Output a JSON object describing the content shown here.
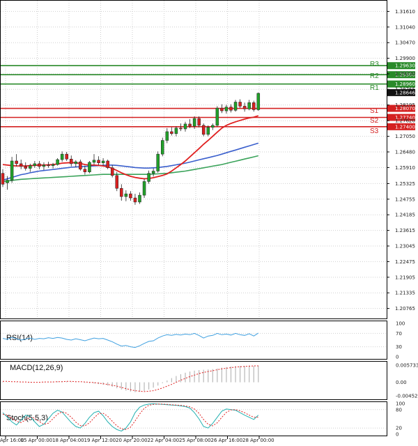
{
  "colors": {
    "bull": "#22a02a",
    "bear": "#d92020",
    "pivot_resistance": "#2a8a2a",
    "pivot_support": "#d42020",
    "ma_fast": "#e02020",
    "ma_mid": "#3a5fcd",
    "ma_slow": "#3aa35a",
    "rsi": "#3fa0e0",
    "macd_hist": "#b8b8b8",
    "macd_signal": "#e02020",
    "stoch_k": "#20b0b0",
    "stoch_d": "#e02020",
    "grid": "#cfcfcf"
  },
  "chart_data": {
    "type": "candlestick",
    "price_axis": {
      "range": [
        1.2045,
        1.319
      ],
      "ticks": [
        "1.31610",
        "1.31040",
        "1.30470",
        "1.29900",
        "1.29330",
        "1.28765",
        "1.28195",
        "1.27620",
        "1.27050",
        "1.26480",
        "1.25910",
        "1.25325",
        "1.24755",
        "1.24185",
        "1.23615",
        "1.23045",
        "1.22475",
        "1.21905",
        "1.21335",
        "1.20765"
      ],
      "current_price_label": "1.28646",
      "grid": true
    },
    "pivot_levels": [
      {
        "name": "R3",
        "value": 1.2963,
        "label": "1.29630",
        "kind": "resistance"
      },
      {
        "name": "R2",
        "value": 1.293,
        "label": "1.29300",
        "kind": "resistance"
      },
      {
        "name": "R1",
        "value": 1.2896,
        "label": "1.28960",
        "kind": "resistance"
      },
      {
        "name": "",
        "value": 1.2807,
        "label": "1.28070",
        "kind": "support"
      },
      {
        "name": "S1",
        "value": 1.2774,
        "label": "1.27740",
        "kind": "support"
      },
      {
        "name": "S2",
        "value": 1.274,
        "label": "1.27400",
        "kind": "support"
      },
      {
        "name": "S3",
        "value": null,
        "label": "",
        "kind": "support"
      }
    ],
    "x_labels": [
      "Apr 16:00",
      "15 Apr 00:00",
      "18 Apr 04:00",
      "19 Apr 12:00",
      "20 Apr 20:00",
      "22 Apr 04:00",
      "25 Apr 08:00",
      "26 Apr 16:00",
      "28 Apr 00:00"
    ],
    "candles": [
      {
        "o": 1.257,
        "h": 1.2585,
        "l": 1.252,
        "c": 1.253
      },
      {
        "o": 1.2535,
        "h": 1.256,
        "l": 1.251,
        "c": 1.2545
      },
      {
        "o": 1.2545,
        "h": 1.263,
        "l": 1.2535,
        "c": 1.2615
      },
      {
        "o": 1.2615,
        "h": 1.264,
        "l": 1.2595,
        "c": 1.2605
      },
      {
        "o": 1.2605,
        "h": 1.262,
        "l": 1.2585,
        "c": 1.2595
      },
      {
        "o": 1.2595,
        "h": 1.261,
        "l": 1.258,
        "c": 1.2588
      },
      {
        "o": 1.2588,
        "h": 1.2605,
        "l": 1.2575,
        "c": 1.2598
      },
      {
        "o": 1.2598,
        "h": 1.2615,
        "l": 1.259,
        "c": 1.2605
      },
      {
        "o": 1.2605,
        "h": 1.2615,
        "l": 1.2585,
        "c": 1.2595
      },
      {
        "o": 1.2595,
        "h": 1.261,
        "l": 1.2582,
        "c": 1.26
      },
      {
        "o": 1.26,
        "h": 1.2612,
        "l": 1.259,
        "c": 1.2598
      },
      {
        "o": 1.2598,
        "h": 1.2608,
        "l": 1.2588,
        "c": 1.2602
      },
      {
        "o": 1.2602,
        "h": 1.2625,
        "l": 1.2598,
        "c": 1.262
      },
      {
        "o": 1.262,
        "h": 1.265,
        "l": 1.2612,
        "c": 1.264
      },
      {
        "o": 1.264,
        "h": 1.2648,
        "l": 1.2615,
        "c": 1.2622
      },
      {
        "o": 1.2622,
        "h": 1.2635,
        "l": 1.2595,
        "c": 1.2605
      },
      {
        "o": 1.2605,
        "h": 1.2618,
        "l": 1.2592,
        "c": 1.2612
      },
      {
        "o": 1.2612,
        "h": 1.262,
        "l": 1.258,
        "c": 1.2585
      },
      {
        "o": 1.2585,
        "h": 1.2598,
        "l": 1.2565,
        "c": 1.2575
      },
      {
        "o": 1.2575,
        "h": 1.2615,
        "l": 1.257,
        "c": 1.261
      },
      {
        "o": 1.261,
        "h": 1.264,
        "l": 1.2602,
        "c": 1.2618
      },
      {
        "o": 1.2618,
        "h": 1.2632,
        "l": 1.26,
        "c": 1.2608
      },
      {
        "o": 1.2608,
        "h": 1.2625,
        "l": 1.2598,
        "c": 1.2615
      },
      {
        "o": 1.2615,
        "h": 1.262,
        "l": 1.2585,
        "c": 1.259
      },
      {
        "o": 1.259,
        "h": 1.26,
        "l": 1.2555,
        "c": 1.2562
      },
      {
        "o": 1.2562,
        "h": 1.2575,
        "l": 1.2505,
        "c": 1.2515
      },
      {
        "o": 1.2515,
        "h": 1.253,
        "l": 1.247,
        "c": 1.2485
      },
      {
        "o": 1.2485,
        "h": 1.2508,
        "l": 1.2468,
        "c": 1.2495
      },
      {
        "o": 1.2495,
        "h": 1.2505,
        "l": 1.247,
        "c": 1.248
      },
      {
        "o": 1.248,
        "h": 1.2495,
        "l": 1.2455,
        "c": 1.2465
      },
      {
        "o": 1.2465,
        "h": 1.25,
        "l": 1.2458,
        "c": 1.249
      },
      {
        "o": 1.249,
        "h": 1.255,
        "l": 1.248,
        "c": 1.254
      },
      {
        "o": 1.254,
        "h": 1.258,
        "l": 1.2532,
        "c": 1.257
      },
      {
        "o": 1.257,
        "h": 1.2588,
        "l": 1.2558,
        "c": 1.2578
      },
      {
        "o": 1.2578,
        "h": 1.265,
        "l": 1.2572,
        "c": 1.264
      },
      {
        "o": 1.264,
        "h": 1.27,
        "l": 1.2632,
        "c": 1.269
      },
      {
        "o": 1.269,
        "h": 1.2735,
        "l": 1.268,
        "c": 1.2722
      },
      {
        "o": 1.2722,
        "h": 1.2738,
        "l": 1.2708,
        "c": 1.2715
      },
      {
        "o": 1.2715,
        "h": 1.2742,
        "l": 1.2705,
        "c": 1.2735
      },
      {
        "o": 1.2735,
        "h": 1.2752,
        "l": 1.2724,
        "c": 1.2732
      },
      {
        "o": 1.2732,
        "h": 1.2758,
        "l": 1.2722,
        "c": 1.275
      },
      {
        "o": 1.275,
        "h": 1.2768,
        "l": 1.2735,
        "c": 1.2742
      },
      {
        "o": 1.2742,
        "h": 1.2778,
        "l": 1.2732,
        "c": 1.277
      },
      {
        "o": 1.277,
        "h": 1.2778,
        "l": 1.2738,
        "c": 1.2745
      },
      {
        "o": 1.2745,
        "h": 1.2752,
        "l": 1.2705,
        "c": 1.2712
      },
      {
        "o": 1.2712,
        "h": 1.2745,
        "l": 1.2705,
        "c": 1.2738
      },
      {
        "o": 1.2738,
        "h": 1.2752,
        "l": 1.2728,
        "c": 1.2745
      },
      {
        "o": 1.2745,
        "h": 1.2815,
        "l": 1.274,
        "c": 1.2808
      },
      {
        "o": 1.2808,
        "h": 1.2822,
        "l": 1.279,
        "c": 1.2798
      },
      {
        "o": 1.2798,
        "h": 1.282,
        "l": 1.2788,
        "c": 1.2812
      },
      {
        "o": 1.2812,
        "h": 1.2822,
        "l": 1.2792,
        "c": 1.28
      },
      {
        "o": 1.28,
        "h": 1.2838,
        "l": 1.2795,
        "c": 1.283
      },
      {
        "o": 1.283,
        "h": 1.284,
        "l": 1.2808,
        "c": 1.2815
      },
      {
        "o": 1.2815,
        "h": 1.2828,
        "l": 1.2795,
        "c": 1.2805
      },
      {
        "o": 1.2805,
        "h": 1.2838,
        "l": 1.28,
        "c": 1.2828
      },
      {
        "o": 1.2828,
        "h": 1.2835,
        "l": 1.2795,
        "c": 1.2802
      },
      {
        "o": 1.2802,
        "h": 1.2865,
        "l": 1.2798,
        "c": 1.2862
      }
    ],
    "moving_averages": {
      "fast": [
        1.2602,
        1.26,
        1.2598,
        1.2597,
        1.2597,
        1.2597,
        1.2598,
        1.2599,
        1.26,
        1.26,
        1.2601,
        1.2602,
        1.2604,
        1.2607,
        1.2608,
        1.2609,
        1.2608,
        1.2606,
        1.2602,
        1.26,
        1.26,
        1.2599,
        1.2597,
        1.2594,
        1.2588,
        1.258,
        1.2572,
        1.2565,
        1.2559,
        1.2555,
        1.2552,
        1.255,
        1.2551,
        1.2554,
        1.2558,
        1.2562,
        1.2568,
        1.2578,
        1.259,
        1.2602,
        1.2615,
        1.263,
        1.2645,
        1.266,
        1.2676,
        1.269,
        1.2705,
        1.272,
        1.2735,
        1.2745,
        1.2752,
        1.2758,
        1.2763,
        1.2768,
        1.2772,
        1.2775,
        1.278
      ],
      "mid": [
        1.2545,
        1.255,
        1.2555,
        1.256,
        1.2565,
        1.2568,
        1.2572,
        1.2575,
        1.2578,
        1.258,
        1.2582,
        1.2584,
        1.2586,
        1.2588,
        1.259,
        1.2592,
        1.2593,
        1.2594,
        1.2595,
        1.2596,
        1.2597,
        1.2598,
        1.2599,
        1.26,
        1.26,
        1.2599,
        1.2597,
        1.2595,
        1.2593,
        1.2591,
        1.259,
        1.2589,
        1.2589,
        1.259,
        1.2591,
        1.2593,
        1.2595,
        1.2598,
        1.2601,
        1.2604,
        1.2607,
        1.2611,
        1.2615,
        1.2619,
        1.2623,
        1.2627,
        1.2631,
        1.2635,
        1.264,
        1.2645,
        1.265,
        1.2655,
        1.266,
        1.2665,
        1.267,
        1.2675,
        1.268
      ],
      "slow": [
        1.254,
        1.2542,
        1.2544,
        1.2546,
        1.2548,
        1.2549,
        1.255,
        1.2551,
        1.2552,
        1.2553,
        1.2554,
        1.2555,
        1.2556,
        1.2557,
        1.2558,
        1.2559,
        1.256,
        1.2561,
        1.2562,
        1.2563,
        1.2564,
        1.2565,
        1.2566,
        1.2566,
        1.2566,
        1.2566,
        1.2566,
        1.2566,
        1.2566,
        1.2566,
        1.2566,
        1.2566,
        1.2566,
        1.2567,
        1.2568,
        1.2569,
        1.257,
        1.2572,
        1.2574,
        1.2576,
        1.2578,
        1.2581,
        1.2584,
        1.2587,
        1.259,
        1.2593,
        1.2596,
        1.2599,
        1.2602,
        1.2606,
        1.261,
        1.2614,
        1.2618,
        1.2622,
        1.2626,
        1.263,
        1.2634
      ]
    },
    "rsi": {
      "label": "RSI(14)",
      "range": [
        0,
        100
      ],
      "ticks": [
        "100",
        "70",
        "30",
        "0"
      ],
      "values": [
        55,
        52,
        58,
        54,
        50,
        53,
        56,
        52,
        55,
        54,
        57,
        55,
        58,
        56,
        52,
        50,
        54,
        51,
        48,
        52,
        56,
        54,
        55,
        50,
        45,
        38,
        32,
        34,
        30,
        28,
        33,
        40,
        46,
        48,
        56,
        62,
        66,
        64,
        67,
        65,
        68,
        66,
        70,
        64,
        56,
        62,
        64,
        70,
        66,
        68,
        65,
        70,
        66,
        64,
        69,
        62,
        71
      ]
    },
    "macd": {
      "label": "MACD(12,26,9)",
      "ticks": [
        "0.005733",
        "0.00",
        "-0.004529"
      ],
      "range": [
        -0.005,
        0.0062
      ],
      "histogram": [
        0.0002,
        0.0001,
        0.0,
        0.0001,
        0.0001,
        0.0,
        -0.0001,
        0.0,
        0.0001,
        0.0001,
        0.0002,
        0.0002,
        0.0003,
        0.0004,
        0.0003,
        0.0002,
        0.0001,
        0.0,
        -0.0002,
        -0.0003,
        -0.0004,
        -0.0006,
        -0.0008,
        -0.0011,
        -0.0015,
        -0.002,
        -0.0024,
        -0.0028,
        -0.0031,
        -0.0033,
        -0.0032,
        -0.0029,
        -0.0024,
        -0.0018,
        -0.0011,
        -0.0003,
        0.0006,
        0.0014,
        0.0021,
        0.0027,
        0.0032,
        0.0036,
        0.0039,
        0.0041,
        0.0042,
        0.0043,
        0.0044,
        0.0046,
        0.0049,
        0.0051,
        0.0053,
        0.0054,
        0.0055,
        0.0055,
        0.0056,
        0.0055,
        0.0056
      ],
      "signal": [
        0.0003,
        0.0003,
        0.0002,
        0.0002,
        0.0001,
        0.0001,
        0.0,
        0.0,
        0.0,
        0.0001,
        0.0001,
        0.0001,
        0.0002,
        0.0002,
        0.0003,
        0.0003,
        0.0002,
        0.0002,
        0.0001,
        0.0,
        -0.0001,
        -0.0003,
        -0.0005,
        -0.0007,
        -0.001,
        -0.0013,
        -0.0017,
        -0.0021,
        -0.0025,
        -0.0028,
        -0.003,
        -0.0031,
        -0.003,
        -0.0028,
        -0.0024,
        -0.0019,
        -0.0013,
        -0.0007,
        0.0,
        0.0007,
        0.0013,
        0.0019,
        0.0024,
        0.0029,
        0.0033,
        0.0036,
        0.0039,
        0.0042,
        0.0045,
        0.0047,
        0.0049,
        0.0051,
        0.0052,
        0.0053,
        0.0054,
        0.0055,
        0.0055
      ]
    },
    "stoch": {
      "label": "Stoch(5,5,3)",
      "ticks": [
        "100",
        "80",
        "20",
        "0"
      ],
      "range": [
        0,
        100
      ],
      "k": [
        70,
        55,
        40,
        30,
        45,
        62,
        58,
        40,
        25,
        32,
        50,
        68,
        78,
        72,
        55,
        38,
        25,
        20,
        35,
        55,
        70,
        75,
        60,
        40,
        25,
        15,
        10,
        20,
        40,
        70,
        88,
        95,
        98,
        99,
        98,
        97,
        96,
        95,
        94,
        92,
        90,
        85,
        70,
        50,
        25,
        20,
        35,
        55,
        75,
        82,
        80,
        78,
        70,
        62,
        55,
        48,
        62
      ],
      "d": [
        65,
        62,
        52,
        42,
        38,
        46,
        55,
        52,
        41,
        32,
        36,
        50,
        65,
        73,
        68,
        55,
        39,
        28,
        27,
        37,
        53,
        67,
        68,
        58,
        42,
        27,
        17,
        15,
        23,
        43,
        66,
        84,
        94,
        97,
        98,
        98,
        97,
        96,
        95,
        94,
        92,
        89,
        82,
        68,
        48,
        32,
        27,
        37,
        55,
        71,
        79,
        80,
        76,
        70,
        62,
        55,
        55
      ]
    }
  }
}
